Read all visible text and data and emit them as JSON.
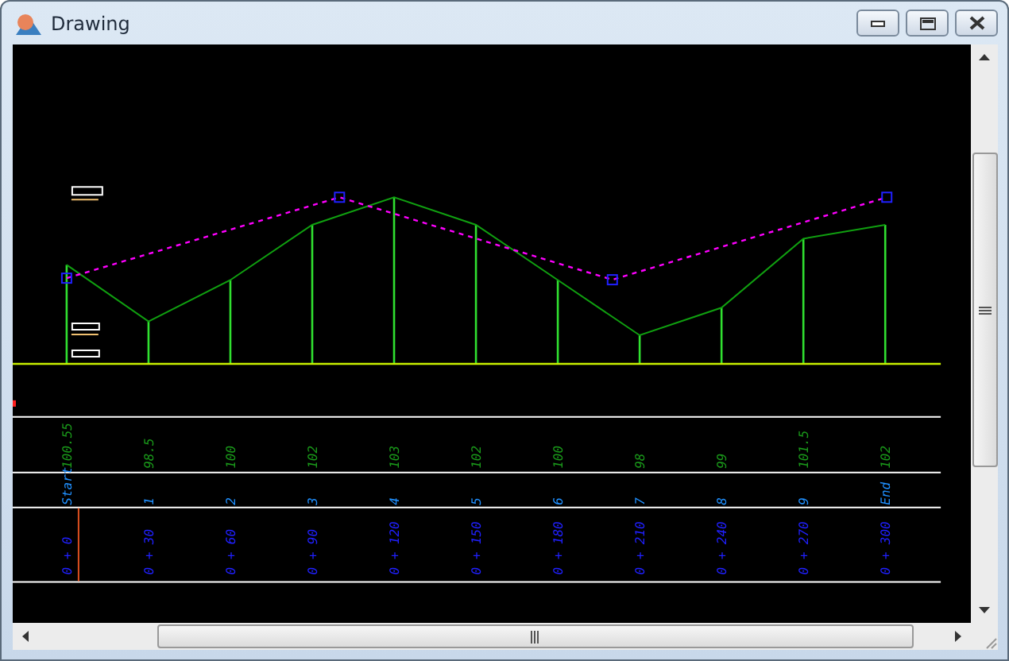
{
  "window": {
    "title": "Drawing"
  },
  "stations": [
    {
      "elevation": "100.55",
      "point": "Start",
      "chainage": "0 + 0"
    },
    {
      "elevation": "98.5",
      "point": "1",
      "chainage": "0 + 30"
    },
    {
      "elevation": "100",
      "point": "2",
      "chainage": "0 + 60"
    },
    {
      "elevation": "102",
      "point": "3",
      "chainage": "0 + 90"
    },
    {
      "elevation": "103",
      "point": "4",
      "chainage": "0 + 120"
    },
    {
      "elevation": "102",
      "point": "5",
      "chainage": "0 + 150"
    },
    {
      "elevation": "100",
      "point": "6",
      "chainage": "0 + 180"
    },
    {
      "elevation": "98",
      "point": "7",
      "chainage": "0 + 210"
    },
    {
      "elevation": "99",
      "point": "8",
      "chainage": "0 + 240"
    },
    {
      "elevation": "101.5",
      "point": "9",
      "chainage": "0 + 270"
    },
    {
      "elevation": "102",
      "point": "End",
      "chainage": "0 + 300"
    }
  ]
}
